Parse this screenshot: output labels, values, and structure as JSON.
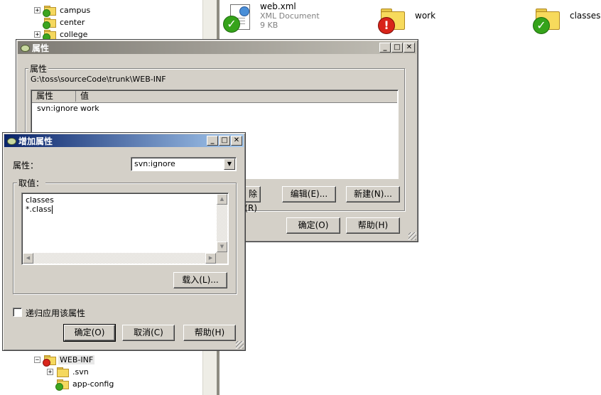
{
  "tree": {
    "top_items": [
      {
        "label": "campus",
        "expander": "+",
        "overlay": "green"
      },
      {
        "label": "center",
        "expander": "",
        "overlay": "green"
      },
      {
        "label": "college",
        "expander": "+",
        "overlay": "green"
      }
    ],
    "bottom_items": [
      {
        "label": "WEB-INF",
        "expander": "−",
        "overlay": "red"
      },
      {
        "label": ".svn",
        "expander": "+",
        "overlay": ""
      },
      {
        "label": "app-config",
        "expander": "",
        "overlay": "green"
      }
    ]
  },
  "files": [
    {
      "name": "web.xml",
      "type": "XML Document",
      "size": "9 KB",
      "icon": "xml-document-icon",
      "overlay": "green"
    },
    {
      "name": "work",
      "icon": "folder-icon",
      "overlay": "red"
    },
    {
      "name": "classes",
      "icon": "folder-icon",
      "overlay": "green"
    }
  ],
  "properties_dialog": {
    "title": "属性",
    "group_label": "属性",
    "path": "G:\\toss\\sourceCode\\trunk\\WEB-INF",
    "columns": [
      "属性",
      "值"
    ],
    "rows": [
      {
        "name": "svn:ignore",
        "value": "work"
      }
    ],
    "remove_label": "除(R)",
    "edit_label": "编辑(E)...",
    "new_label": "新建(N)...",
    "ok_label": "确定(O)",
    "help_label": "帮助(H)"
  },
  "add_property_dialog": {
    "title": "增加属性",
    "property_label": "属性：",
    "property_value": "svn:ignore",
    "value_group_label": "取值：",
    "value_lines": [
      "classes",
      "*.class"
    ],
    "load_label": "载入(L)...",
    "recursive_label": "递归应用该属性",
    "recursive_checked": false,
    "ok_label": "确定(O)",
    "cancel_label": "取消(C)",
    "help_label": "帮助(H)"
  }
}
